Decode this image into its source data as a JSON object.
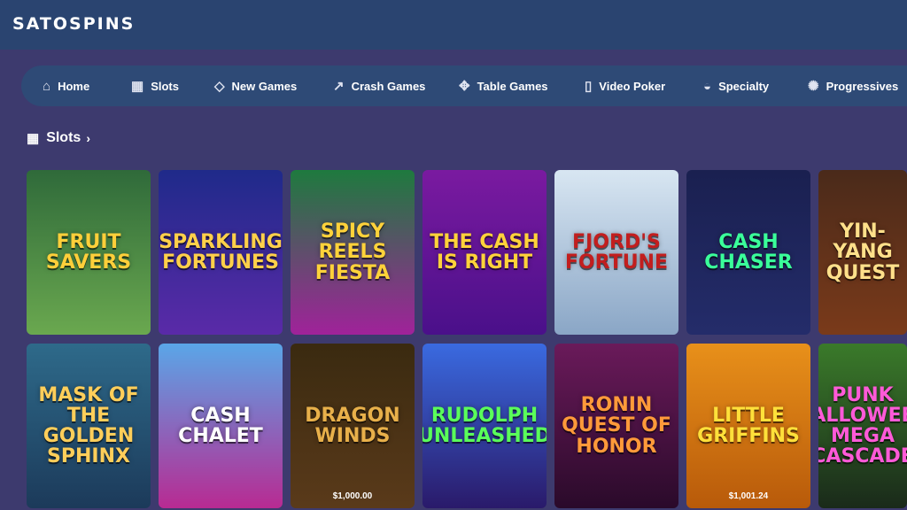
{
  "logo": "SATOSPINS",
  "nav": [
    {
      "label": "Home",
      "icon": "home-icon",
      "glyph": "⌂"
    },
    {
      "label": "Slots",
      "icon": "slot-machine-icon",
      "glyph": "▦"
    },
    {
      "label": "New Games",
      "icon": "diamond-icon",
      "glyph": "◇"
    },
    {
      "label": "Crash Games",
      "icon": "rocket-icon",
      "glyph": "↗"
    },
    {
      "label": "Table Games",
      "icon": "cards-icon",
      "glyph": "✥"
    },
    {
      "label": "Video Poker",
      "icon": "poker-icon",
      "glyph": "▯"
    },
    {
      "label": "Specialty",
      "icon": "specialty-icon",
      "glyph": "◒"
    },
    {
      "label": "Progressives",
      "icon": "progressive-icon",
      "glyph": "✺"
    }
  ],
  "section": {
    "title": "Slots",
    "icon": "slot-machine-icon",
    "glyph": "▦",
    "chevron": "›"
  },
  "games_row1": [
    {
      "name": "Fruit Savers",
      "color_top": "#2f6a3a",
      "color_bottom": "#6aa84f",
      "text_color": "#ffcf3a"
    },
    {
      "name": "Sparkling Fortunes",
      "color_top": "#1f2a8a",
      "color_bottom": "#5a2aa8",
      "text_color": "#ffd04a"
    },
    {
      "name": "Spicy Reels Fiesta",
      "color_top": "#1e7a3e",
      "color_bottom": "#a0229a",
      "text_color": "#ffd23a"
    },
    {
      "name": "The Cash is Right",
      "color_top": "#7a1aa0",
      "color_bottom": "#4a108a",
      "text_color": "#ffd23a"
    },
    {
      "name": "Fjord's Fortune",
      "color_top": "#d8e6f2",
      "color_bottom": "#8aa6c6",
      "text_color": "#c21e1e"
    },
    {
      "name": "Cash Chaser",
      "color_top": "#1a2050",
      "color_bottom": "#242c6a",
      "text_color": "#3aff9a"
    },
    {
      "name": "Yin-Yang Quest",
      "color_top": "#4a2a1a",
      "color_bottom": "#7a3a1a",
      "text_color": "#ffe08a"
    }
  ],
  "games_row2": [
    {
      "name": "Mask of the Golden Sphinx",
      "color_top": "#2e6a8a",
      "color_bottom": "#1c3a5a",
      "text_color": "#ffce5a",
      "jackpot": ""
    },
    {
      "name": "Cash Chalet",
      "color_top": "#5aa6e8",
      "color_bottom": "#b82a92",
      "text_color": "#ffffff",
      "jackpot": ""
    },
    {
      "name": "Dragon Winds",
      "color_top": "#3a2a10",
      "color_bottom": "#5a3a1a",
      "text_color": "#e8b04a",
      "jackpot": "$1,000.00"
    },
    {
      "name": "Rudolph Unleashed",
      "color_top": "#3a6ae0",
      "color_bottom": "#2a1a6a",
      "text_color": "#5aff5a",
      "jackpot": ""
    },
    {
      "name": "Ronin Quest of Honor",
      "color_top": "#6a1a5a",
      "color_bottom": "#2a0a2a",
      "text_color": "#ff9a3a",
      "jackpot": ""
    },
    {
      "name": "Little Griffins",
      "color_top": "#e8901a",
      "color_bottom": "#b85a0a",
      "text_color": "#ffe03a",
      "jackpot": "$1,001.24"
    },
    {
      "name": "Punk Halloween Mega Cascade",
      "color_top": "#3a7a2a",
      "color_bottom": "#1a2a1a",
      "text_color": "#ff5ad8",
      "jackpot": ""
    }
  ]
}
